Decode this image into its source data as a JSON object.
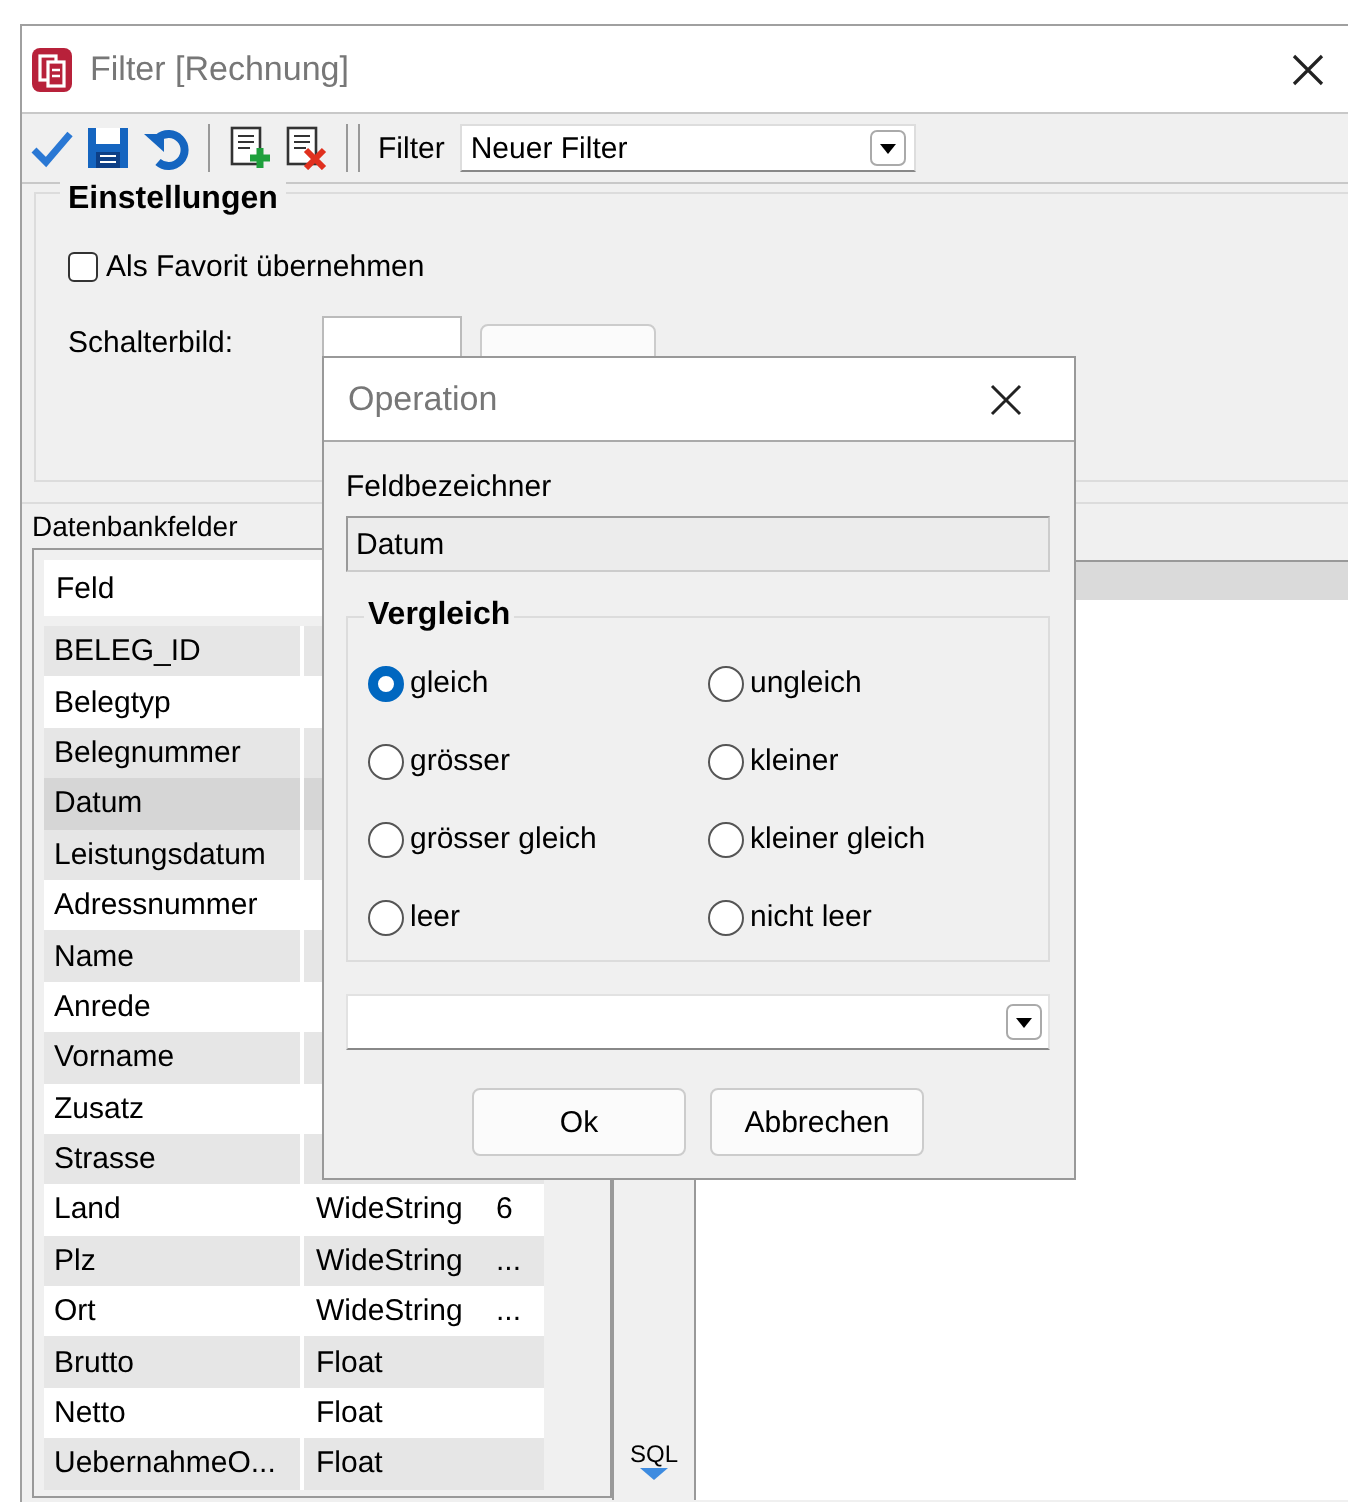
{
  "window": {
    "title": "Filter  [Rechnung]"
  },
  "toolbar": {
    "filter_label": "Filter",
    "filter_value": "Neuer Filter"
  },
  "settings": {
    "title": "Einstellungen",
    "favorite": {
      "label": "Als Favorit übernehmen",
      "checked": false
    },
    "button_image_label": "Schalterbild:"
  },
  "fields_panel": {
    "title": "Datenbankfelder",
    "header": "Feld",
    "rows": [
      {
        "name": "BELEG_ID",
        "selected": false
      },
      {
        "name": "Belegtyp",
        "selected": false
      },
      {
        "name": "Belegnummer",
        "selected": false
      },
      {
        "name": "Datum",
        "selected": true
      },
      {
        "name": "Leistungsdatum",
        "selected": false
      },
      {
        "name": "Adressnummer",
        "selected": false
      },
      {
        "name": "Name",
        "selected": false
      },
      {
        "name": "Anrede",
        "selected": false
      },
      {
        "name": "Vorname",
        "selected": false
      },
      {
        "name": "Zusatz",
        "selected": false
      },
      {
        "name": "Strasse",
        "selected": false
      },
      {
        "name": "Land",
        "type": "WideString",
        "size": "6",
        "selected": false
      },
      {
        "name": "Plz",
        "type": "WideString",
        "size": "...",
        "selected": false
      },
      {
        "name": "Ort",
        "type": "WideString",
        "size": "...",
        "selected": false
      },
      {
        "name": "Brutto",
        "type": "Float",
        "selected": false
      },
      {
        "name": "Netto",
        "type": "Float",
        "selected": false
      },
      {
        "name": "UebernahmeO...",
        "type": "Float",
        "selected": false
      }
    ]
  },
  "sql_tab": "SQL",
  "dialog": {
    "title": "Operation",
    "field_label": "Feldbezeichner",
    "field_value": "Datum",
    "group": "Vergleich",
    "options": [
      {
        "label": "gleich",
        "selected": true
      },
      {
        "label": "ungleich",
        "selected": false
      },
      {
        "label": "grösser",
        "selected": false
      },
      {
        "label": "kleiner",
        "selected": false
      },
      {
        "label": "grösser gleich",
        "selected": false
      },
      {
        "label": "kleiner gleich",
        "selected": false
      },
      {
        "label": "leer",
        "selected": false
      },
      {
        "label": "nicht leer",
        "selected": false
      }
    ],
    "buttons": [
      "Ok",
      "Abbrechen"
    ]
  }
}
